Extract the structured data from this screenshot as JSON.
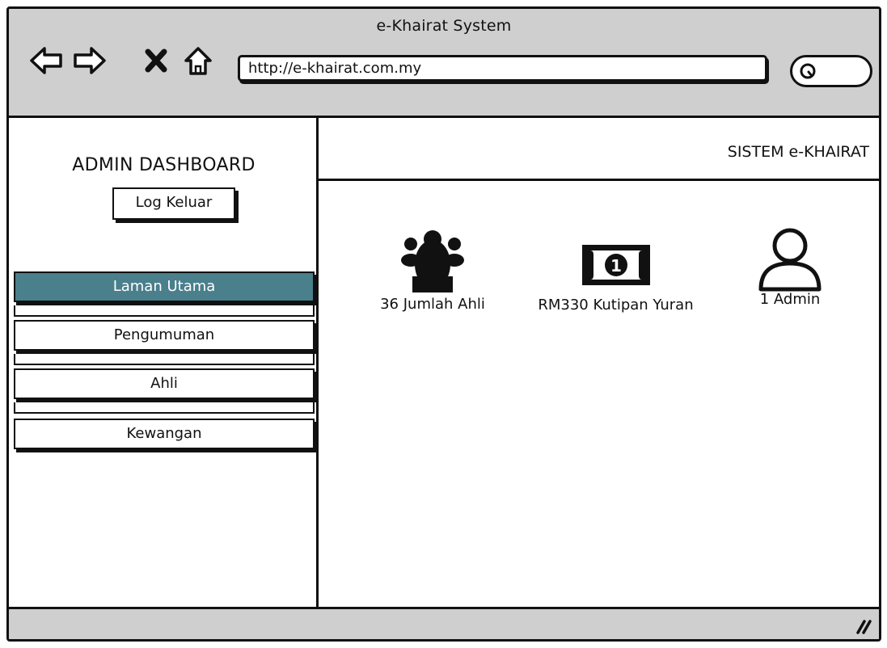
{
  "window": {
    "title": "e-Khairat System"
  },
  "browser": {
    "url": "http://e-khairat.com.my",
    "nav_icons": [
      "back-arrow-icon",
      "forward-arrow-icon",
      "close-icon",
      "home-icon"
    ],
    "search_icon": "search-icon"
  },
  "sidebar": {
    "title": "ADMIN DASHBOARD",
    "logout_label": "Log Keluar",
    "items": [
      {
        "label": "Laman Utama",
        "active": true
      },
      {
        "label": "Pengumuman",
        "active": false
      },
      {
        "label": "Ahli",
        "active": false
      },
      {
        "label": "Kewangan",
        "active": false
      }
    ]
  },
  "header": {
    "title": "SISTEM e-KHAIRAT"
  },
  "stats": [
    {
      "icon": "group-icon",
      "label": "36 Jumlah Ahli"
    },
    {
      "icon": "money-icon",
      "label": "RM330 Kutipan Yuran"
    },
    {
      "icon": "user-icon",
      "label": "1 Admin"
    }
  ],
  "colors": {
    "active_menu": "#4a7f8c",
    "chrome": "#cfcfcf"
  }
}
